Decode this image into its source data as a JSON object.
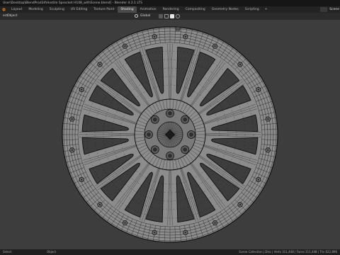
{
  "window": {
    "title": "User\\Desktop\\BlendProd34\\Hostile Sprocket H108_withScene.blend] - Blender 4.2.1 LTS"
  },
  "topbar": {
    "tabs": [
      "Layout",
      "Modeling",
      "Sculpting",
      "UV Editing",
      "Texture Paint",
      "Shading",
      "Animation",
      "Rendering",
      "Compositing",
      "Geometry Nodes",
      "Scripting",
      "+"
    ],
    "active_tab": "Shading",
    "scene_label": "Scene"
  },
  "header": {
    "mode": "ect",
    "object_menu": "Object",
    "orientation": "Global"
  },
  "statusbar": {
    "left": "Select",
    "mid": "Object",
    "right": "Scene Collection | Disc | Verts 311,448 | Faces 311,448 | Tris 622,896"
  },
  "colors": {
    "wire": "#101010",
    "mesh_fill": "#8c8c8c",
    "viewport_bg": "#3d3d3d"
  }
}
